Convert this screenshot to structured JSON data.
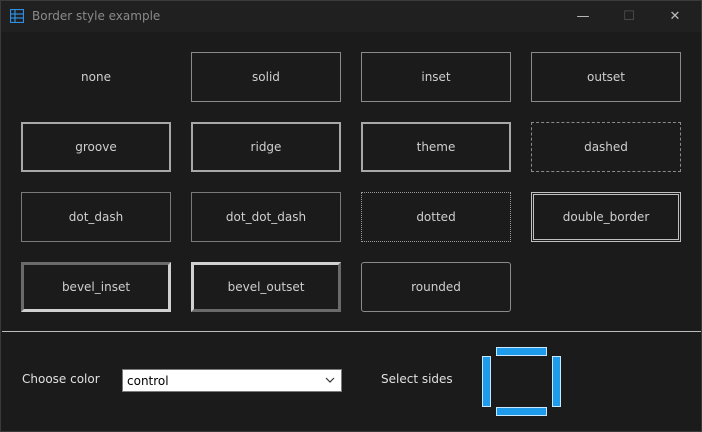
{
  "window": {
    "title": "Border style example",
    "minimize_glyph": "—",
    "maximize_glyph": "☐",
    "close_glyph": "✕"
  },
  "boxes": [
    {
      "label": "none"
    },
    {
      "label": "solid"
    },
    {
      "label": "inset"
    },
    {
      "label": "outset"
    },
    {
      "label": "groove"
    },
    {
      "label": "ridge"
    },
    {
      "label": "theme"
    },
    {
      "label": "dashed"
    },
    {
      "label": "dot_dash"
    },
    {
      "label": "dot_dot_dash"
    },
    {
      "label": "dotted"
    },
    {
      "label": "double_border"
    },
    {
      "label": "bevel_inset"
    },
    {
      "label": "bevel_outset"
    },
    {
      "label": "rounded"
    }
  ],
  "controls": {
    "choose_color_label": "Choose color",
    "color_value": "control",
    "select_sides_label": "Select sides"
  },
  "colors": {
    "side_selected": "#1e9bea",
    "background": "#1b1b1b"
  }
}
